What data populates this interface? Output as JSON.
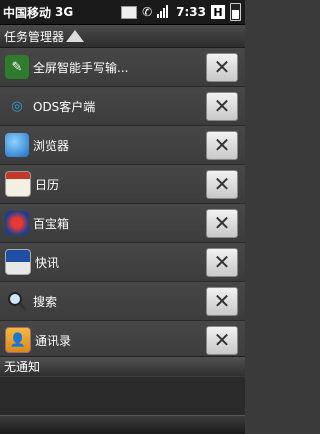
{
  "status_bar": {
    "carrier": "中国移动",
    "network": "3G",
    "time": "7:33",
    "h_indicator": "H"
  },
  "panel": {
    "title": "任务管理器"
  },
  "tasks": [
    {
      "label": "全屏智能手写输...",
      "icon": "handwriting-ime-icon"
    },
    {
      "label": "ODS客户端",
      "icon": "ods-client-icon"
    },
    {
      "label": "浏览器",
      "icon": "browser-globe-icon"
    },
    {
      "label": "日历",
      "icon": "calendar-icon"
    },
    {
      "label": "百宝箱",
      "icon": "treasure-box-icon"
    },
    {
      "label": "快讯",
      "icon": "news-flash-icon"
    },
    {
      "label": "搜索",
      "icon": "magnifier-icon"
    },
    {
      "label": "通讯录",
      "icon": "contacts-icon"
    }
  ],
  "close_glyph": "✕",
  "notifications": {
    "empty_label": "无通知"
  }
}
